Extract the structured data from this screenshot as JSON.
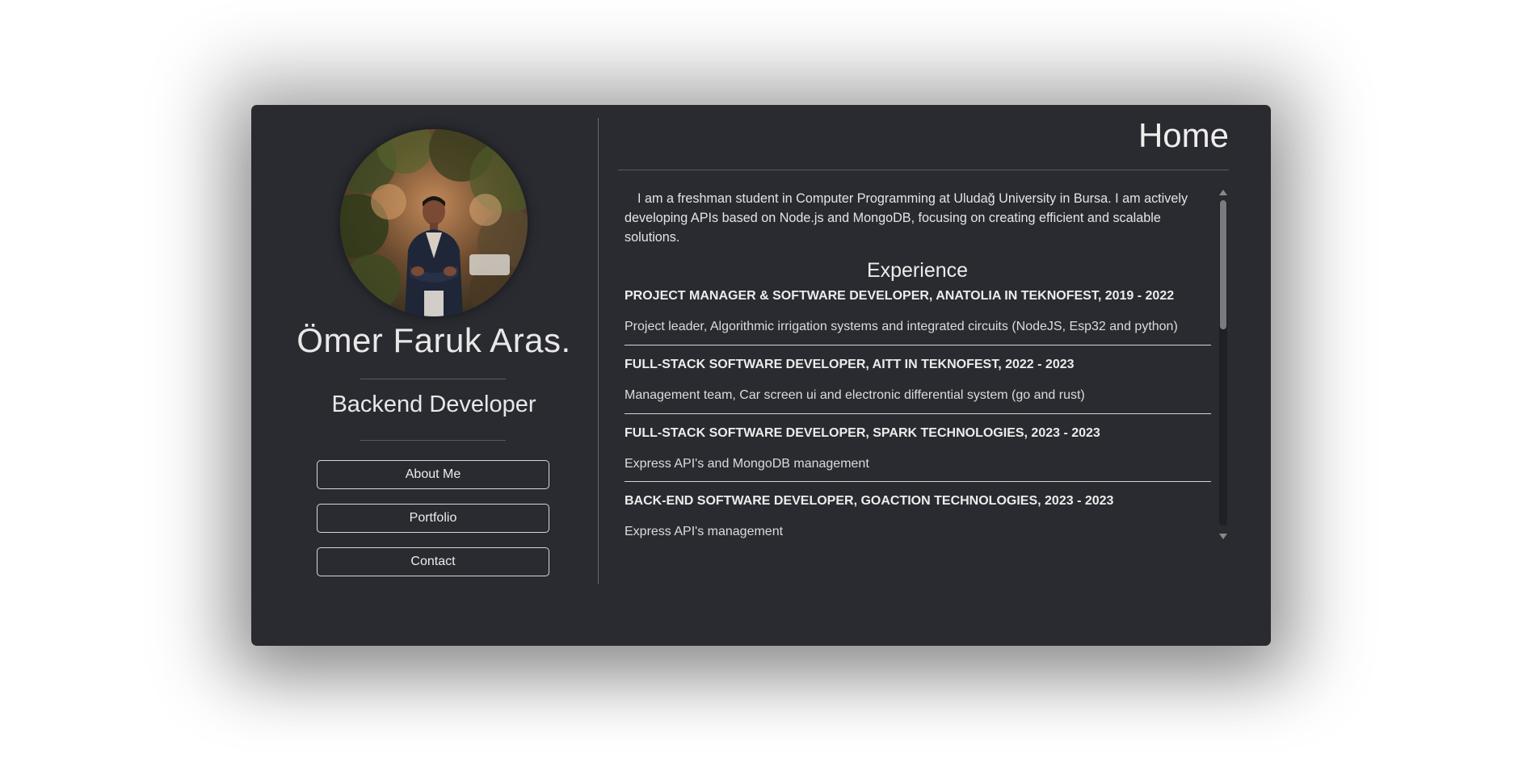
{
  "profile": {
    "name": "Ömer Faruk Aras.",
    "role": "Backend Developer"
  },
  "nav": {
    "about": "About Me",
    "portfolio": "Portfolio",
    "contact": "Contact"
  },
  "main": {
    "title": "Home",
    "intro": "I am a freshman student in Computer Programming at Uludağ University in Bursa. I am actively developing APIs based on Node.js and MongoDB, focusing on creating efficient and scalable solutions.",
    "experience_heading": "Experience",
    "jobs": [
      {
        "title": "PROJECT MANAGER & SOFTWARE DEVELOPER, ANATOLIA IN TEKNOFEST, 2019 - 2022",
        "desc": "Project leader, Algorithmic irrigation systems and integrated circuits (NodeJS, Esp32 and python)"
      },
      {
        "title": "FULL-STACK SOFTWARE DEVELOPER, AITT IN TEKNOFEST, 2022 - 2023",
        "desc": "Management team, Car screen ui and electronic differential system (go and rust)"
      },
      {
        "title": "FULL-STACK SOFTWARE DEVELOPER, SPARK TECHNOLOGIES, 2023 - 2023",
        "desc": "Express API's and MongoDB management"
      },
      {
        "title": "BACK-END SOFTWARE DEVELOPER, GOACTION TECHNOLOGIES, 2023 - 2023",
        "desc": "Express API's management"
      }
    ]
  },
  "colors": {
    "card_bg": "#2a2b31",
    "text": "#e6e6e6",
    "divider": "#6a6b70"
  }
}
